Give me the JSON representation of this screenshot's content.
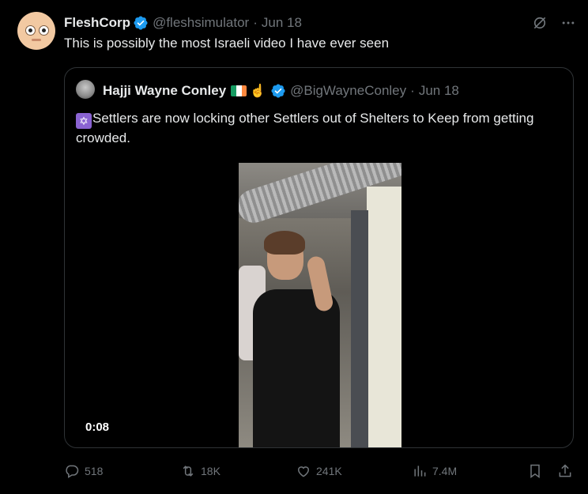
{
  "tweet": {
    "author_name": "FleshCorp",
    "author_handle": "@fleshsimulator",
    "separator": "·",
    "date": "Jun 18",
    "text": "This is possibly the most Israeli video I have ever seen"
  },
  "quote": {
    "author_name": "Hajji Wayne Conley",
    "flag_colors": [
      "#169b62",
      "#ffffff",
      "#ff883e"
    ],
    "finger_glyph": "☝",
    "author_handle": "@BigWayneConley",
    "separator": "·",
    "date": "Jun 18",
    "text_emoji": "✡",
    "text": "Settlers are now locking other Settlers out of Shelters to Keep from getting crowded.",
    "video_time": "0:08"
  },
  "actions": {
    "replies": "518",
    "retweets": "18K",
    "likes": "241K",
    "views": "7.4M"
  },
  "colors": {
    "background": "#000000",
    "text": "#e7e9ea",
    "muted": "#71767b",
    "verified": "#1d9bf0",
    "border": "#2f3336"
  },
  "icons": [
    "grok-icon",
    "more-icon",
    "verified-icon",
    "reply-icon",
    "retweet-icon",
    "like-icon",
    "views-icon",
    "bookmark-icon",
    "share-icon"
  ]
}
